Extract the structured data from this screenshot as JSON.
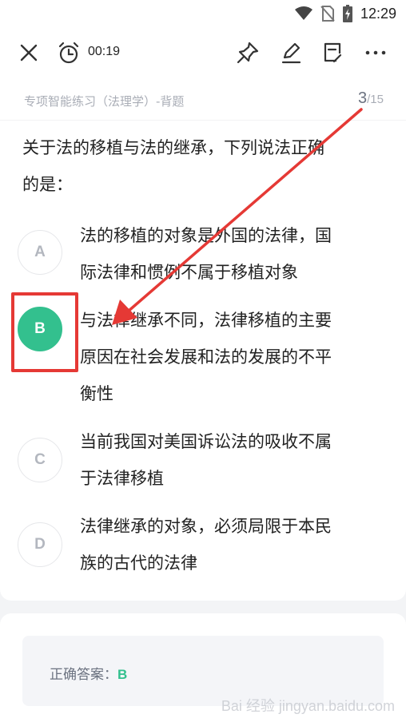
{
  "status_bar": {
    "time": "12:29",
    "icons": [
      "wifi-icon",
      "no-sim-icon",
      "battery-charging-icon"
    ]
  },
  "toolbar": {
    "timer": "00:19",
    "icons": [
      "close-icon",
      "alarm-clock-icon",
      "pin-icon",
      "edit-icon",
      "note-icon",
      "more-icon"
    ]
  },
  "subject": {
    "title": "专项智能练习（法理学）-背题",
    "current": "3",
    "total": "/15"
  },
  "question": {
    "line1": "关于法的移植与法的继承，下列说法正确",
    "line2": "的是："
  },
  "options": [
    {
      "letter": "A",
      "lines": [
        "法的移植的对象是外国的法律，国",
        "际法律和惯例不属于移植对象"
      ],
      "selected": false
    },
    {
      "letter": "B",
      "lines": [
        "与法律继承不同，法律移植的主要",
        "原因在社会发展和法的发展的不平",
        "衡性"
      ],
      "selected": true
    },
    {
      "letter": "C",
      "lines": [
        "当前我国对美国诉讼法的吸收不属",
        "于法律移植"
      ],
      "selected": false
    },
    {
      "letter": "D",
      "lines": [
        "法律继承的对象，必须局限于本民",
        "族的古代的法律"
      ],
      "selected": false
    }
  ],
  "answer": {
    "label": "正确答案：",
    "value": "B"
  },
  "colors": {
    "accent": "#33c08e",
    "highlight": "#e53935"
  },
  "watermark": "Bai 经验 jingyan.baidu.com"
}
